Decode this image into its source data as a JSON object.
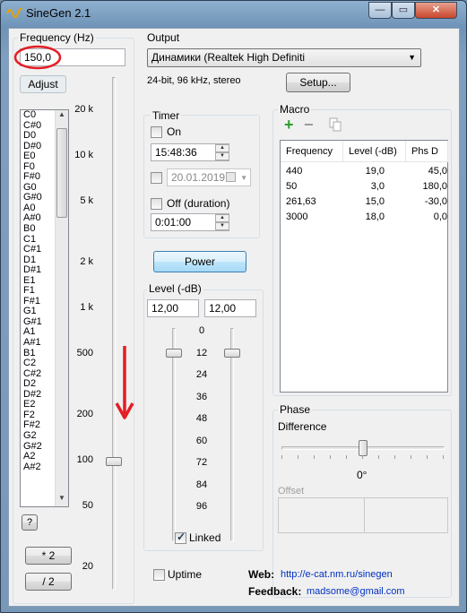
{
  "window": {
    "title": "SineGen 2.1",
    "controls": {
      "minimize": "—",
      "maximize": "▭",
      "close": "✕"
    }
  },
  "frequency": {
    "label": "Frequency (Hz)",
    "value": "150,0",
    "adjust_label": "Adjust",
    "notes": [
      "C0",
      "C#0",
      "D0",
      "D#0",
      "E0",
      "F0",
      "F#0",
      "G0",
      "G#0",
      "A0",
      "A#0",
      "B0",
      "C1",
      "C#1",
      "D1",
      "D#1",
      "E1",
      "F1",
      "F#1",
      "G1",
      "G#1",
      "A1",
      "A#1",
      "B1",
      "C2",
      "C#2",
      "D2",
      "D#2",
      "E2",
      "F2",
      "F#2",
      "G2",
      "G#2",
      "A2",
      "A#2"
    ],
    "scale": [
      "20 k",
      "10 k",
      "5 k",
      "2 k",
      "1 k",
      "500",
      "200",
      "100",
      "50",
      "20"
    ],
    "slider_level": 0.75,
    "help_label": "?",
    "double_label": "* 2",
    "half_label": "/ 2"
  },
  "output": {
    "label": "Output",
    "device": "Динамики (Realtek High Definiti",
    "format": "24-bit, 96 kHz, stereo",
    "setup_label": "Setup..."
  },
  "timer": {
    "label": "Timer",
    "on_label": "On",
    "on_time": "15:48:36",
    "date": "20.01.2019",
    "off_label": "Off (duration)",
    "duration": "0:01:00"
  },
  "power_label": "Power",
  "level": {
    "label": "Level (-dB)",
    "left_value": "12,00",
    "right_value": "12,00",
    "ticks": [
      "0",
      "12",
      "24",
      "36",
      "48",
      "60",
      "72",
      "84",
      "96"
    ],
    "linked_label": "Linked",
    "linked": true
  },
  "macro": {
    "label": "Macro",
    "add_icon": "plus-icon",
    "remove_icon": "minus-icon",
    "copy_icon": "copy-icon",
    "columns": [
      "Frequency",
      "Level (-dB)",
      "Phs D"
    ],
    "rows": [
      {
        "freq": "440",
        "level": "19,0",
        "phase": "45,0"
      },
      {
        "freq": "50",
        "level": "3,0",
        "phase": "180,0"
      },
      {
        "freq": "261,63",
        "level": "15,0",
        "phase": "-30,0"
      },
      {
        "freq": "3000",
        "level": "18,0",
        "phase": "0,0"
      }
    ]
  },
  "phase": {
    "label": "Phase",
    "difference_label": "Difference",
    "value": "0°",
    "offset_label": "Offset"
  },
  "footer": {
    "uptime_label": "Uptime",
    "web_label": "Web:",
    "web_link": "http://e-cat.nm.ru/sinegen",
    "feedback_label": "Feedback:",
    "feedback_email": "madsome@gmail.com"
  },
  "annotation_color": "#e31e24"
}
